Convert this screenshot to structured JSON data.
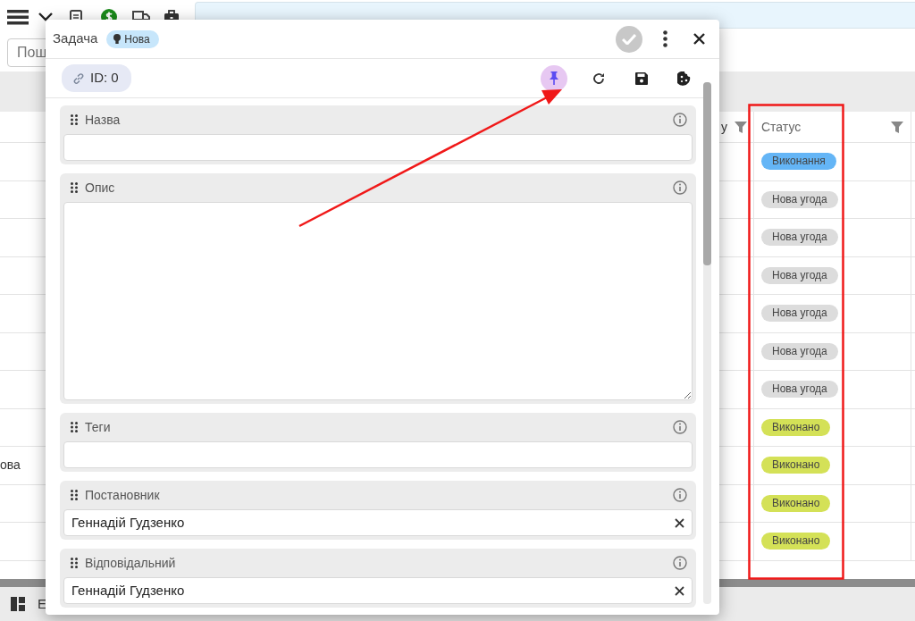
{
  "search": {
    "placeholder": "Пош"
  },
  "table": {
    "columns": [
      {
        "label": "у"
      },
      {
        "label": "Статус"
      }
    ],
    "rows": [
      {
        "cell": "",
        "status": {
          "label": "Виконання",
          "color": "#64b5f6"
        }
      },
      {
        "cell": "",
        "status": {
          "label": "Нова угода",
          "color": "#dcdcdc"
        }
      },
      {
        "cell": "",
        "status": {
          "label": "Нова угода",
          "color": "#dcdcdc"
        }
      },
      {
        "cell": "",
        "status": {
          "label": "Нова угода",
          "color": "#dcdcdc"
        }
      },
      {
        "cell": "",
        "status": {
          "label": "Нова угода",
          "color": "#dcdcdc"
        }
      },
      {
        "cell": "",
        "status": {
          "label": "Нова угода",
          "color": "#dcdcdc"
        }
      },
      {
        "cell": "",
        "status": {
          "label": "Нова угода",
          "color": "#dcdcdc"
        }
      },
      {
        "cell": "",
        "status": {
          "label": "Виконано",
          "color": "#d4e157"
        }
      },
      {
        "cell": "ова",
        "status": {
          "label": "Виконано",
          "color": "#d4e157"
        }
      },
      {
        "cell": "",
        "status": {
          "label": "Виконано",
          "color": "#d4e157"
        }
      },
      {
        "cell": "",
        "status": {
          "label": "Виконано",
          "color": "#d4e157"
        }
      }
    ]
  },
  "bottom_bar": {
    "label": "E"
  },
  "dialog": {
    "title": "Задача",
    "state_badge": "Нова",
    "confirm_disabled": true,
    "id_chip": "ID: 0",
    "pin_selected": true,
    "fields": [
      {
        "kind": "text",
        "label": "Назва"
      },
      {
        "kind": "textarea",
        "label": "Опис"
      },
      {
        "kind": "text",
        "label": "Теги"
      },
      {
        "kind": "select",
        "label": "Постановник",
        "value": "Геннадій Гудзенко"
      },
      {
        "kind": "select",
        "label": "Відповідальний",
        "value": "Геннадій Гудзенко"
      }
    ]
  }
}
